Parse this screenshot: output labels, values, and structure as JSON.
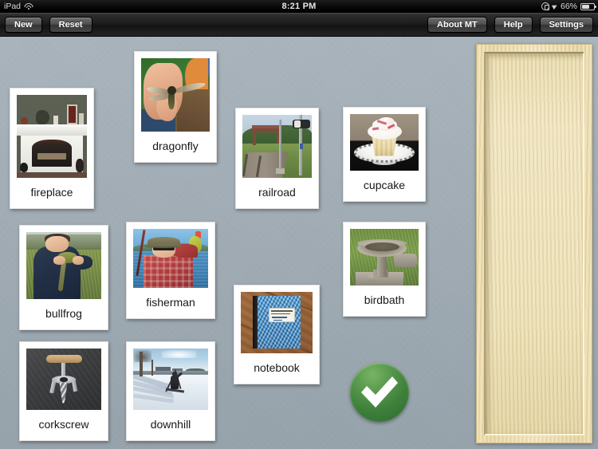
{
  "status_bar": {
    "device": "iPad",
    "wifi_icon": "wifi-icon",
    "time": "8:21 PM",
    "rotation_lock_icon": "rotation-lock-icon",
    "location_icon": "location-arrow-icon",
    "battery_percent": "66%",
    "battery_icon": "battery-icon"
  },
  "toolbar": {
    "left_buttons": [
      {
        "label": "New",
        "name": "new-button"
      },
      {
        "label": "Reset",
        "name": "reset-button"
      }
    ],
    "right_buttons": [
      {
        "label": "About MT",
        "name": "about-mt-button"
      },
      {
        "label": "Help",
        "name": "help-button"
      },
      {
        "label": "Settings",
        "name": "settings-button"
      }
    ]
  },
  "workspace": {
    "cards": [
      {
        "label": "fireplace",
        "name": "card-fireplace"
      },
      {
        "label": "dragonfly",
        "name": "card-dragonfly"
      },
      {
        "label": "railroad",
        "name": "card-railroad"
      },
      {
        "label": "cupcake",
        "name": "card-cupcake"
      },
      {
        "label": "bullfrog",
        "name": "card-bullfrog"
      },
      {
        "label": "fisherman",
        "name": "card-fisherman"
      },
      {
        "label": "birdbath",
        "name": "card-birdbath"
      },
      {
        "label": "notebook",
        "name": "card-notebook"
      },
      {
        "label": "corkscrew",
        "name": "card-corkscrew"
      },
      {
        "label": "downhill",
        "name": "card-downhill"
      }
    ],
    "check_button": {
      "name": "check-answer-button",
      "icon": "checkmark-icon",
      "color": "#3d7f3a"
    },
    "answer_tray": {
      "name": "answer-tray",
      "content": ""
    }
  },
  "colors": {
    "background": "#a2aeb7",
    "toolbar": "#1a1a1a",
    "check_green": "#3d7f3a",
    "tray_wood": "#ecdfb4"
  }
}
